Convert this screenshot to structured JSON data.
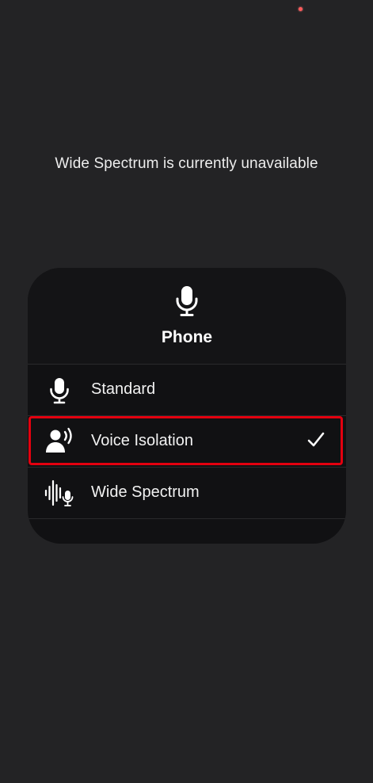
{
  "notice": {
    "text": "Wide Spectrum is currently unavailable"
  },
  "panel": {
    "header_icon": "microphone-icon",
    "title": "Phone",
    "options": [
      {
        "label": "Standard",
        "icon": "microphone-icon",
        "selected": false
      },
      {
        "label": "Voice Isolation",
        "icon": "voice-isolation-icon",
        "selected": true
      },
      {
        "label": "Wide Spectrum",
        "icon": "wide-spectrum-icon",
        "selected": false
      }
    ]
  },
  "colors": {
    "background": "#232325",
    "panel": "#111113",
    "highlight": "#e3000f"
  }
}
